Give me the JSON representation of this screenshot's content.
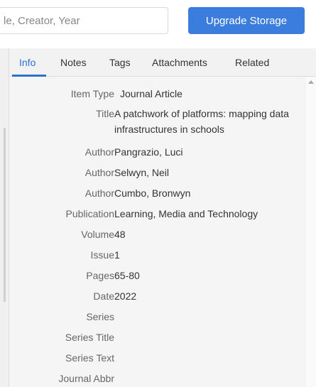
{
  "search": {
    "text": "le, Creator, Year"
  },
  "toolbar": {
    "upgrade_label": "Upgrade Storage"
  },
  "tabs": [
    {
      "label": "Info",
      "active": true
    },
    {
      "label": "Notes",
      "active": false
    },
    {
      "label": "Tags",
      "active": false
    },
    {
      "label": "Attachments",
      "active": false
    },
    {
      "label": "Related",
      "active": false
    }
  ],
  "fields": [
    {
      "label": "Item Type",
      "value": "Journal Article"
    },
    {
      "label": "Title",
      "value": "A patchwork of platforms: mapping data infrastructures in schools"
    },
    {
      "label": "Author",
      "value": "Pangrazio, Luci"
    },
    {
      "label": "Author",
      "value": "Selwyn, Neil"
    },
    {
      "label": "Author",
      "value": "Cumbo, Bronwyn"
    },
    {
      "label": "Publication",
      "value": "Learning, Media and Technology"
    },
    {
      "label": "Volume",
      "value": "48"
    },
    {
      "label": "Issue",
      "value": "1"
    },
    {
      "label": "Pages",
      "value": "65-80"
    },
    {
      "label": "Date",
      "value": "2022"
    },
    {
      "label": "Series",
      "value": ""
    },
    {
      "label": "Series Title",
      "value": ""
    },
    {
      "label": "Series Text",
      "value": ""
    },
    {
      "label": "Journal Abbr",
      "value": ""
    }
  ],
  "colors": {
    "accent": "#3b7ddd",
    "active_tab": "#2f6fcf"
  }
}
